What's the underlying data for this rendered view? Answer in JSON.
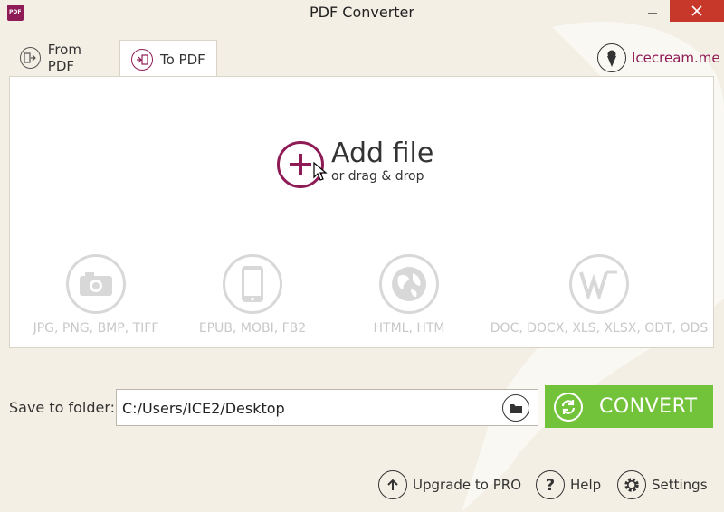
{
  "window": {
    "title": "PDF Converter",
    "app_icon_text": "PDF"
  },
  "tabs": [
    {
      "label": "From PDF",
      "active": false
    },
    {
      "label": "To PDF",
      "active": true
    }
  ],
  "brand": {
    "label": "Icecream.me"
  },
  "add_file": {
    "title": "Add file",
    "subtitle": "or drag & drop"
  },
  "formats": [
    {
      "icon": "camera-icon",
      "label": "JPG, PNG, BMP, TIFF"
    },
    {
      "icon": "tablet-icon",
      "label": "EPUB, MOBI, FB2"
    },
    {
      "icon": "globe-icon",
      "label": "HTML, HTM"
    },
    {
      "icon": "word-icon",
      "label": "DOC, DOCX, XLS, XLSX, ODT, ODS"
    }
  ],
  "save": {
    "label": "Save to folder:",
    "path": "C:/Users/ICE2/Desktop"
  },
  "convert": {
    "label": "CONVERT"
  },
  "links": {
    "upgrade": "Upgrade to PRO",
    "help": "Help",
    "settings": "Settings"
  },
  "colors": {
    "accent": "#8e1b56",
    "convert": "#72c23a",
    "close": "#c7382a",
    "background": "#f4efe4"
  }
}
